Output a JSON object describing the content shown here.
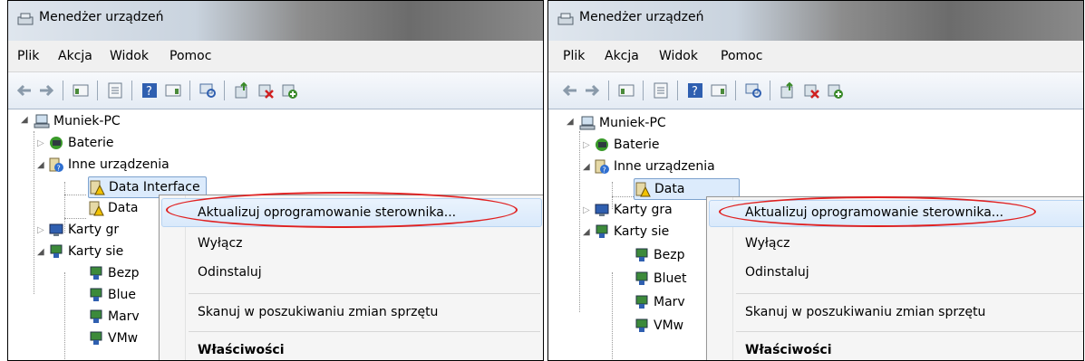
{
  "window": {
    "title": "Menedżer urządzeń"
  },
  "menu": [
    "Plik",
    "Akcja",
    "Widok",
    "Pomoc"
  ],
  "toolbar": [
    "back-icon",
    "forward-icon",
    "properties-icon",
    "details-icon",
    "help-icon",
    "view-icon",
    "scan-icon",
    "update-driver-icon",
    "uninstall-icon",
    "add-hardware-icon"
  ],
  "left": {
    "tree": {
      "root": "Muniek-PC",
      "baterie": "Baterie",
      "inne": "Inne urządzenia",
      "data1": "Data Interface",
      "data2": "Data",
      "karty_gr": "Karty gr",
      "karty_sie": "Karty sie",
      "bezp": "Bezp",
      "blue": "Blue",
      "marv": "Marv",
      "vmw": "VMw"
    }
  },
  "right": {
    "tree": {
      "root": "Muniek-PC",
      "baterie": "Baterie",
      "inne": "Inne urządzenia",
      "data1": "Data",
      "karty_gr": "Karty gra",
      "karty_sie": "Karty sie",
      "bezp": "Bezp",
      "bluet": "Bluet",
      "marv": "Marv",
      "vmw": "VMw"
    }
  },
  "context_menu": {
    "update": "Aktualizuj oprogramowanie sterownika...",
    "disable": "Wyłącz",
    "uninstall": "Odinstaluj",
    "scan": "Skanuj w poszukiwaniu zmian sprzętu",
    "properties": "Właściwości"
  },
  "colors": {
    "highlight_ellipse": "#e02020",
    "selection": "#dcebfc"
  }
}
